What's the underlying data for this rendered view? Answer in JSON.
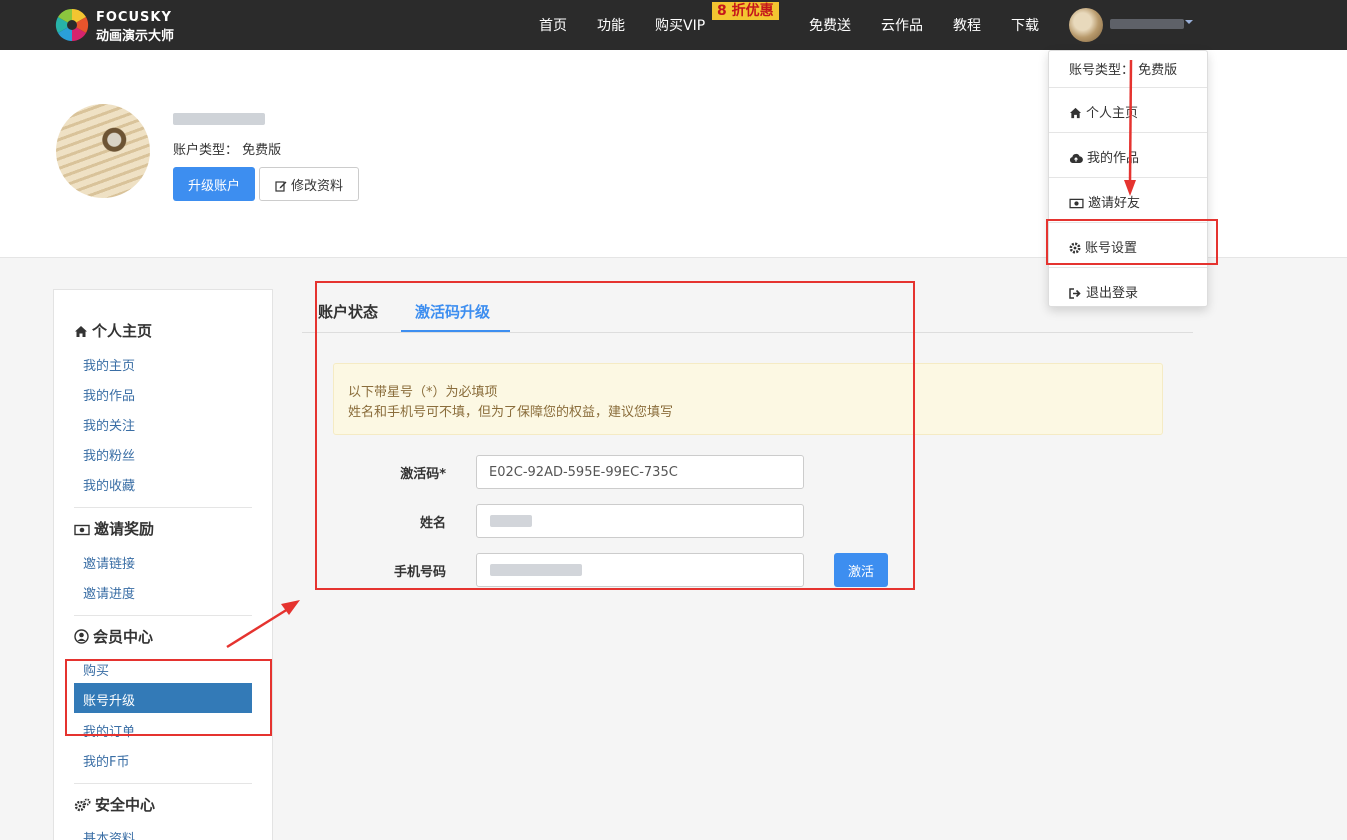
{
  "brand": {
    "name_en": "FOCUSKY",
    "name_cn": "动画演示大师"
  },
  "nav": {
    "items": [
      "首页",
      "功能",
      "购买VIP",
      "免费送",
      "云作品",
      "教程",
      "下载"
    ],
    "promo_badge": "8 折优惠"
  },
  "profile": {
    "account_type_label": "账户类型：",
    "account_type_value": "免费版",
    "upgrade_button": "升级账户",
    "edit_button": "修改资料"
  },
  "sidebar": {
    "sections": [
      {
        "title": "个人主页",
        "icon": "home-icon",
        "items": [
          "我的主页",
          "我的作品",
          "我的关注",
          "我的粉丝",
          "我的收藏"
        ]
      },
      {
        "title": "邀请奖励",
        "icon": "money-icon",
        "items": [
          "邀请链接",
          "邀请进度"
        ]
      },
      {
        "title": "会员中心",
        "icon": "user-circle-icon",
        "items": [
          "购买",
          "账号升级",
          "我的订单",
          "我的F币"
        ],
        "active": "账号升级"
      },
      {
        "title": "安全中心",
        "icon": "cogs-icon",
        "items": [
          "基本资料"
        ]
      }
    ]
  },
  "tabs": {
    "items": [
      "账户状态",
      "激活码升级"
    ],
    "active": "激活码升级"
  },
  "notice": {
    "line1": "以下带星号（*）为必填项",
    "line2": "姓名和手机号可不填，但为了保障您的权益，建议您填写"
  },
  "form": {
    "code_label": "激活码*",
    "code_value": "E02C-92AD-595E-99EC-735C",
    "name_label": "姓名",
    "phone_label": "手机号码",
    "activate_button": "激活"
  },
  "dropdown": {
    "type_label": "账号类型：",
    "type_value": "免费版",
    "items": [
      {
        "label": "个人主页",
        "icon": "home-icon"
      },
      {
        "label": "我的作品",
        "icon": "cloud-icon"
      },
      {
        "label": "邀请好友",
        "icon": "money-icon"
      },
      {
        "label": "账号设置",
        "icon": "gear-icon"
      },
      {
        "label": "退出登录",
        "icon": "sign-out-icon"
      }
    ]
  },
  "colors": {
    "primary": "#3d8ef0",
    "topbar": "#2b2b2b",
    "annotation": "#e5332f",
    "active_nav": "#337ab7"
  }
}
